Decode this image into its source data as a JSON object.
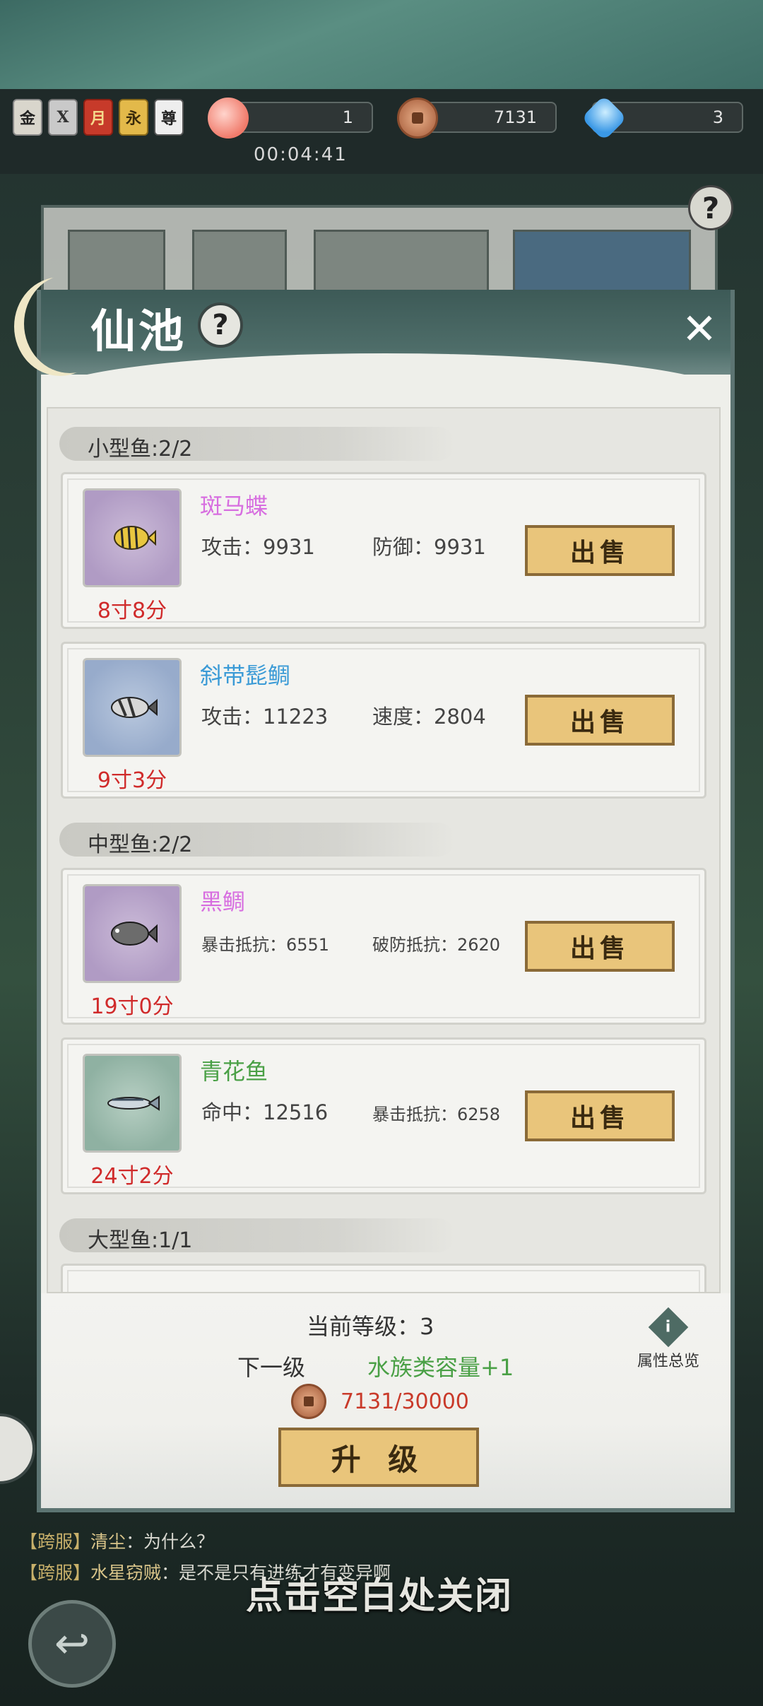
{
  "hud": {
    "badges": [
      "金",
      "X",
      "月",
      "永",
      "尊"
    ],
    "peach_value": "1",
    "coin_value": "7131",
    "gem_value": "3",
    "timer": "00:04:41"
  },
  "modal": {
    "title": "仙池",
    "help_glyph": "?",
    "close_glyph": "✕"
  },
  "sections": {
    "small": "小型鱼:2/2",
    "medium": "中型鱼:2/2",
    "large": "大型鱼:1/1"
  },
  "fish": [
    {
      "name": "斑马蝶",
      "name_color": "#d76ee0",
      "stat1": "攻击：9931",
      "stat2": "防御：9931",
      "size": "8寸8分",
      "sell": "出售"
    },
    {
      "name": "斜带髭鲷",
      "name_color": "#3a9ad6",
      "stat1": "攻击：11223",
      "stat2": "速度：2804",
      "size": "9寸3分",
      "sell": "出售"
    },
    {
      "name": "黑鲷",
      "name_color": "#d76ee0",
      "stat1": "暴击抵抗：6551",
      "stat2": "破防抵抗：2620",
      "size": "19寸0分",
      "sell": "出售"
    },
    {
      "name": "青花鱼",
      "name_color": "#4aa046",
      "stat1": "命中：12516",
      "stat2": "暴击抵抗：6258",
      "size": "24寸2分",
      "sell": "出售"
    }
  ],
  "footer": {
    "level": "当前等级：3",
    "next_label": "下一级",
    "next_value": "水族类容量+1",
    "attr_overview": "属性总览",
    "info_glyph": "i",
    "cost": "7131/30000",
    "upgrade": "升 级"
  },
  "chat": [
    {
      "channel": "【跨服】",
      "user": "清尘",
      "msg": "：为什么？"
    },
    {
      "channel": "【跨服】",
      "user": "水星窃贼",
      "msg": "：是不是只有进练才有变异啊"
    }
  ],
  "close_hint": "点击空白处关闭",
  "back_glyph": "↩"
}
